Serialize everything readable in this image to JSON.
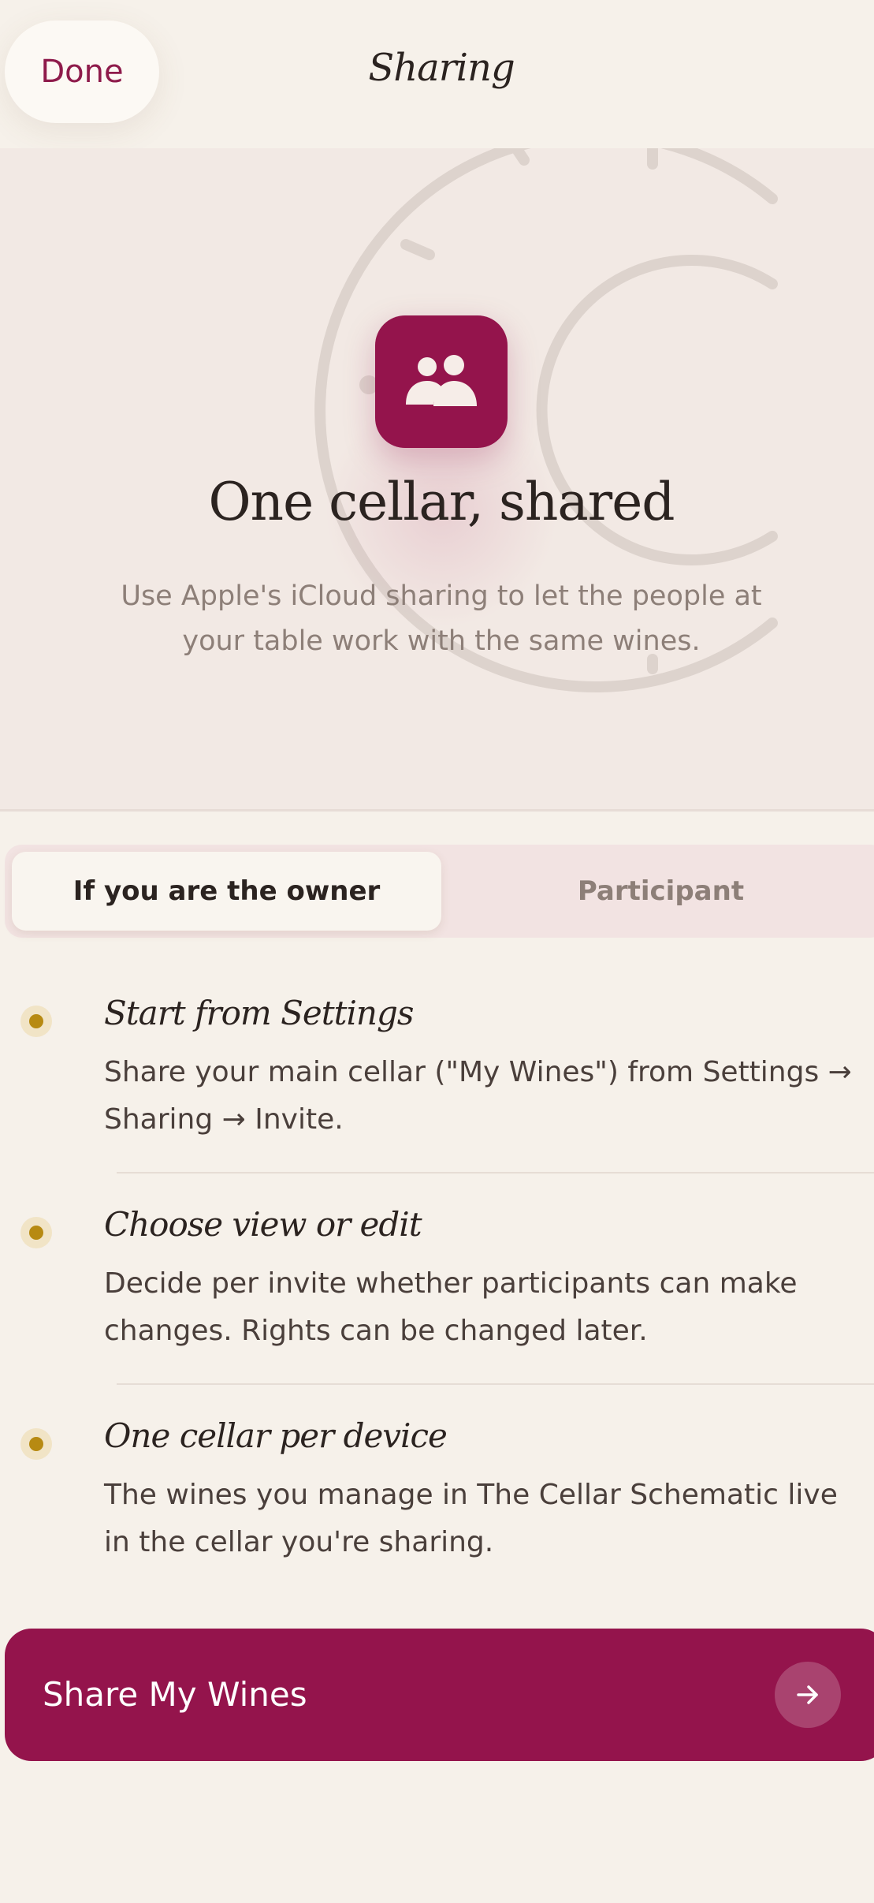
{
  "nav": {
    "done_label": "Done",
    "title": "Sharing"
  },
  "hero": {
    "icon": "people-icon",
    "title": "One cellar, shared",
    "subtitle_lines": [
      "Use Apple's iCloud sharing to let the people at",
      "your table work with the same wines."
    ]
  },
  "segmented": {
    "options": [
      "If you are the owner",
      "Participant"
    ],
    "selected": "If you are the owner"
  },
  "steps": [
    {
      "title": "Start from Settings",
      "body_lines": [
        "Share your main cellar (\"My Wines\") from Settings →",
        "Sharing → Invite."
      ]
    },
    {
      "title": "Choose view or edit",
      "body_lines": [
        "Decide per invite whether participants can make",
        "changes. Rights can be changed later."
      ]
    },
    {
      "title": "One cellar per device",
      "body_lines": [
        "The wines you manage in The Cellar Schematic live",
        "in the cellar you're sharing."
      ]
    }
  ],
  "cta": {
    "label": "Share My Wines",
    "icon": "arrow-right-icon"
  },
  "colors": {
    "accent": "#94144c",
    "background": "#f6f1ea",
    "hero_background": "#f2e9e4",
    "bullet": "#b78a12"
  }
}
